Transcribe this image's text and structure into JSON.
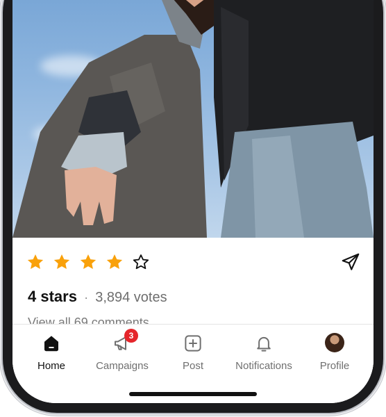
{
  "post": {
    "rating_text": "4 stars",
    "separator": "·",
    "votes_text": "3,894 votes",
    "comments_link": "View all 69 comments",
    "stars_filled": 4,
    "stars_total": 5
  },
  "colors": {
    "star_filled": "#F9A10B",
    "badge": "#E5252B",
    "active_tab": "#111111",
    "inactive_tab": "#6F6F6F"
  },
  "tabbar": {
    "items": [
      {
        "label": "Home",
        "icon": "home-icon",
        "active": true
      },
      {
        "label": "Campaigns",
        "icon": "megaphone-icon",
        "badge": "3"
      },
      {
        "label": "Post",
        "icon": "plus-square-icon"
      },
      {
        "label": "Notifications",
        "icon": "bell-icon"
      },
      {
        "label": "Profile",
        "icon": "avatar"
      }
    ]
  }
}
